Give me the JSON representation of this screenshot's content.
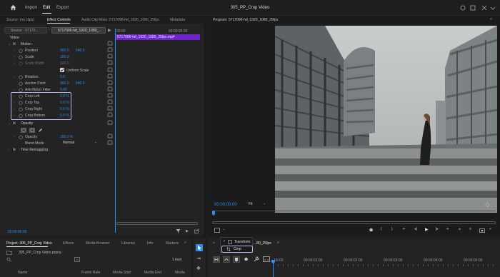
{
  "app": {
    "title": "305_PP_Crop Video",
    "menu": [
      "Import",
      "Edit",
      "Export"
    ]
  },
  "panel_tabs": [
    "Source: (no clips)",
    "Effect Controls",
    "Audio Clip Mixer: 5717096-hd_1920_1080_25fps",
    "Metadata"
  ],
  "effect_controls": {
    "source_chip": "Source · 57170...",
    "clip_chip": "5717096-hd_1920_1080_...",
    "ruler_start": "00:00",
    "ruler_end": "00:00:05:00",
    "clip_name": "5717096-hd_1920_1080_25fps.mp4",
    "video_header": "Video",
    "motion": "Motion",
    "position": {
      "label": "Position",
      "x": "960.0",
      "y": "540.0"
    },
    "scale": {
      "label": "Scale",
      "value": "100.0"
    },
    "scale_width": {
      "label": "Scale Width",
      "value": "100.0"
    },
    "uniform_scale": "Uniform Scale",
    "rotation": {
      "label": "Rotation",
      "value": "0.0"
    },
    "anchor_point": {
      "label": "Anchor Point",
      "x": "960.0",
      "y": "540.0"
    },
    "anti_flicker": {
      "label": "Anti-flicker Filter",
      "value": "0.00"
    },
    "crop_left": {
      "label": "Crop Left",
      "value": "0.0 %"
    },
    "crop_top": {
      "label": "Crop Top",
      "value": "0.0 %"
    },
    "crop_right": {
      "label": "Crop Right",
      "value": "0.0 %"
    },
    "crop_bottom": {
      "label": "Crop Bottom",
      "value": "0.0 %"
    },
    "opacity_group": "Opacity",
    "opacity": {
      "label": "Opacity",
      "value": "100.0 %"
    },
    "blend_mode": {
      "label": "Blend Mode",
      "value": "Normal"
    },
    "time_remapping": "Time Remapping",
    "timecode": "00:00:00:00"
  },
  "program": {
    "title": "Program: 5717096-hd_1920_1080_25fps",
    "timecode": "00:00:00:00",
    "fit": "Fit"
  },
  "bottom_tabs": [
    "Project: 305_PP_Crop Video",
    "Effects",
    "Media Browser",
    "Libraries",
    "Info",
    "Markers"
  ],
  "project": {
    "file": "305_PP_Crop Video.prproj",
    "items": "1 item",
    "columns": [
      "Name",
      "Frame Rate",
      "Media Start",
      "Media End",
      "Media"
    ]
  },
  "timeline": {
    "sequence_tab": "...80_25fps",
    "ruler": [
      "00:00",
      "00:00:01:00",
      "00:00:02:00",
      "00:00:03:00",
      "00:00:04:00",
      "00:00:05:00"
    ]
  },
  "popup": {
    "items": [
      {
        "label": "Transform",
        "checked": true
      },
      {
        "label": "Crop",
        "checked": false
      }
    ]
  },
  "colors": {
    "accent": "#2d8ceb",
    "clip": "#6c26c8",
    "highlight": "#c2b8f0"
  }
}
